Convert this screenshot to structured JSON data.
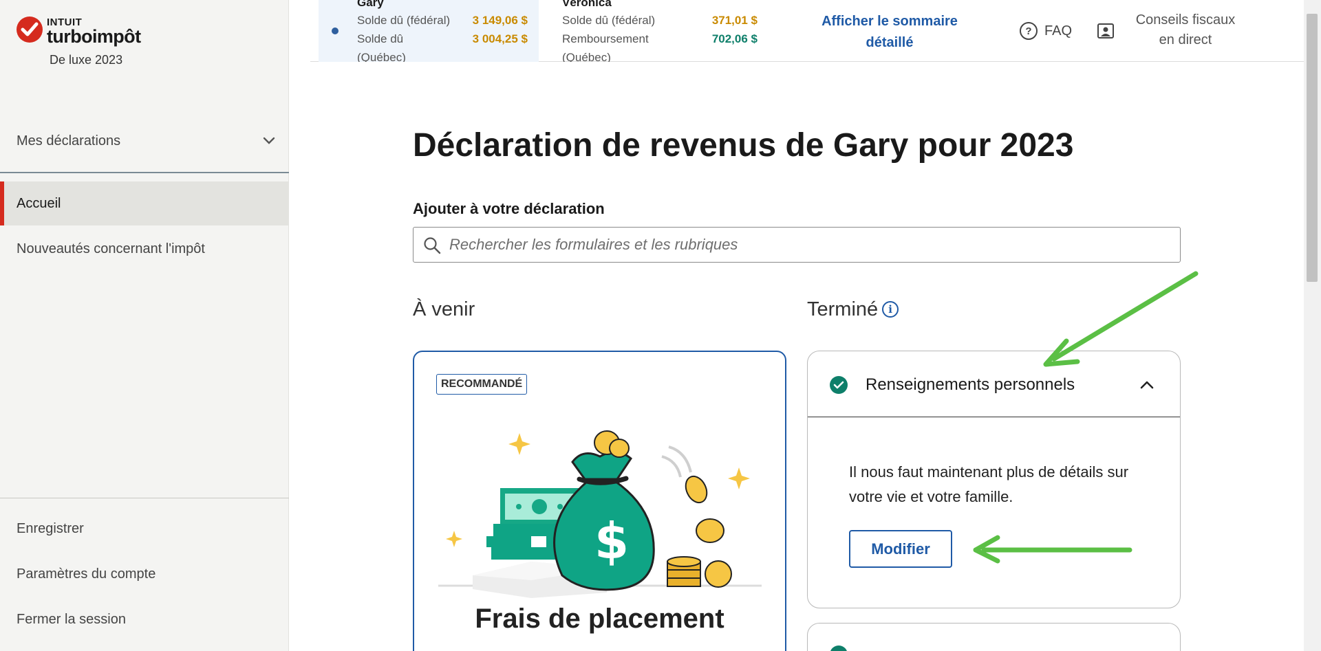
{
  "app": {
    "brand_intuit": "INTUIT",
    "brand_product": "turboimpôt",
    "edition": "De luxe 2023"
  },
  "sidebar": {
    "my_returns": "Mes déclarations",
    "items": [
      {
        "label": "Accueil",
        "active": true
      },
      {
        "label": "Nouveautés concernant l'impôt",
        "active": false
      }
    ],
    "footer": [
      "Enregistrer",
      "Paramètres du compte",
      "Fermer la session"
    ]
  },
  "topbar": {
    "persons": [
      {
        "name": "Gary",
        "rows": [
          {
            "label": "Solde dû (fédéral)",
            "amount": "3  149,06  $",
            "kind": "owe"
          },
          {
            "label": "Solde dû",
            "label2": "(Québec)",
            "amount": "3  004,25  $",
            "kind": "owe"
          }
        ]
      },
      {
        "name": "Véronica",
        "rows": [
          {
            "label": "Solde dû (fédéral)",
            "amount": "371,01  $",
            "kind": "owe"
          },
          {
            "label": "Remboursement",
            "label2": "(Québec)",
            "amount": "702,06  $",
            "kind": "refund"
          }
        ]
      }
    ],
    "summary_link": "Afficher le sommaire détaillé",
    "faq": "FAQ",
    "live_advice": "Conseils fiscaux en direct"
  },
  "main": {
    "title": "Déclaration de revenus de Gary pour 2023",
    "add_label": "Ajouter à votre déclaration",
    "search_placeholder": "Rechercher les formulaires et les rubriques",
    "upcoming_heading": "À venir",
    "done_heading": "Terminé",
    "recommended_card": {
      "badge": "RECOMMANDÉ",
      "title": "Frais de placement"
    },
    "done_card": {
      "title": "Renseignements personnels",
      "text": "Il nous faut maintenant plus de détails sur votre vie et votre famille.",
      "button": "Modifier"
    }
  },
  "colors": {
    "brand_red": "#d52b1e",
    "link_blue": "#1f5aa6",
    "owe": "#c98a00",
    "refund": "#0e7f6a",
    "annotation_arrow": "#5bbf45"
  },
  "icons": [
    "chevron-down-icon",
    "question-icon",
    "expert-icon",
    "search-icon",
    "info-icon",
    "check-circle-icon",
    "chevron-up-icon",
    "money-bag-illustration"
  ]
}
